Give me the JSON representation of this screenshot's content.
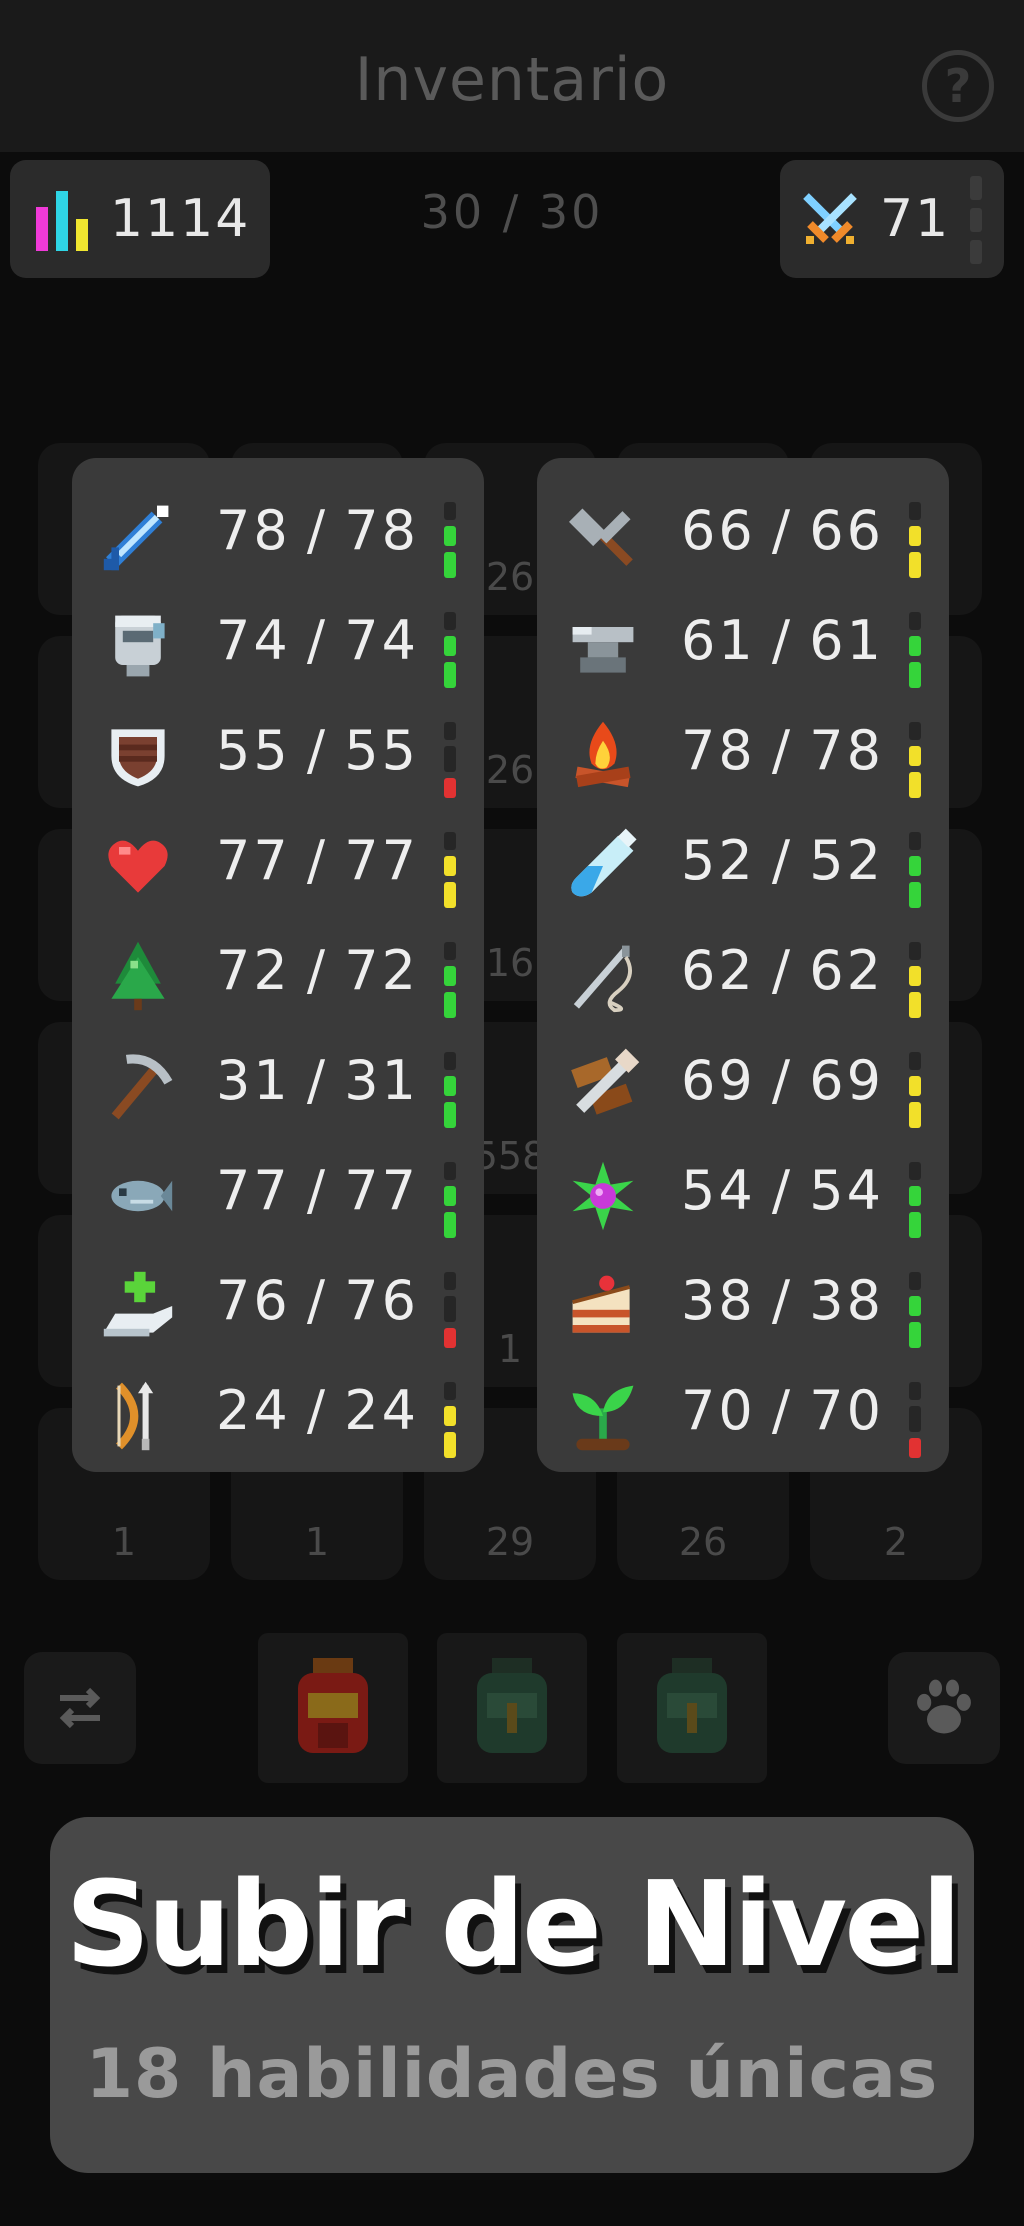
{
  "header": {
    "title": "Inventario",
    "help_icon": "question-circle-icon"
  },
  "stats": {
    "score": "1114",
    "score_icon": "bar-chart-icon",
    "slots": "30 / 30",
    "combat_level": "71",
    "combat_icon": "crossed-swords-icon"
  },
  "background_counts": [
    "26",
    "26",
    "16",
    "558",
    "1",
    "1",
    "1",
    "29",
    "26",
    "2"
  ],
  "skills_left": [
    {
      "icon": "sword-icon",
      "value": "78 / 78",
      "meter": "green"
    },
    {
      "icon": "helmet-icon",
      "value": "74 / 74",
      "meter": "green"
    },
    {
      "icon": "shield-icon",
      "value": "55 / 55",
      "meter": "red"
    },
    {
      "icon": "heart-icon",
      "value": "77 / 77",
      "meter": "yellow"
    },
    {
      "icon": "tree-icon",
      "value": "72 / 72",
      "meter": "green"
    },
    {
      "icon": "pickaxe-icon",
      "value": "31 / 31",
      "meter": "green"
    },
    {
      "icon": "fish-icon",
      "value": "77 / 77",
      "meter": "green"
    },
    {
      "icon": "healing-hand-icon",
      "value": "76 / 76",
      "meter": "red"
    },
    {
      "icon": "bow-icon",
      "value": "24 / 24",
      "meter": "yellow"
    }
  ],
  "skills_right": [
    {
      "icon": "hammer-icon",
      "value": "66 / 66",
      "meter": "yellow"
    },
    {
      "icon": "anvil-icon",
      "value": "61 / 61",
      "meter": "green"
    },
    {
      "icon": "campfire-icon",
      "value": "78 / 78",
      "meter": "yellow"
    },
    {
      "icon": "potion-vial-icon",
      "value": "52 / 52",
      "meter": "green"
    },
    {
      "icon": "needle-thread-icon",
      "value": "62 / 62",
      "meter": "yellow"
    },
    {
      "icon": "saw-wood-icon",
      "value": "69 / 69",
      "meter": "yellow"
    },
    {
      "icon": "magic-gem-icon",
      "value": "54 / 54",
      "meter": "green"
    },
    {
      "icon": "cake-icon",
      "value": "38 / 38",
      "meter": "green"
    },
    {
      "icon": "sprout-icon",
      "value": "70 / 70",
      "meter": "red"
    }
  ],
  "colors": {
    "green": "#35d43a",
    "yellow": "#f2e02a",
    "red": "#e23232",
    "meter_bg": "#262626"
  },
  "banner": {
    "title": "Subir de Nivel",
    "subtitle": "18 habilidades únicas"
  }
}
